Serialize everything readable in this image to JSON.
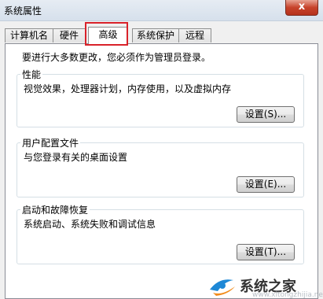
{
  "window": {
    "title": "系统属性",
    "close_glyph": "x"
  },
  "tabs": [
    {
      "label": "计算机名"
    },
    {
      "label": "硬件"
    },
    {
      "label": "高级"
    },
    {
      "label": "系统保护"
    },
    {
      "label": "远程"
    }
  ],
  "active_tab": "高级",
  "panel": {
    "intro": "要进行大多数更改，您必须作为管理员登录。",
    "groups": [
      {
        "title": "性能",
        "description": "视觉效果，处理器计划，内存使用，以及虚拟内存",
        "button": "设置(S)..."
      },
      {
        "title": "用户配置文件",
        "description": "与您登录有关的桌面设置",
        "button": "设置(E)..."
      },
      {
        "title": "启动和故障恢复",
        "description": "系统启动、系统失败和调试信息",
        "button": "设置(T)..."
      }
    ]
  },
  "watermark": {
    "text": "系统之家",
    "url": "www.xitongzhijia.net",
    "colors": {
      "logo_blue": "#1e88d6",
      "logo_orange": "#f28c1b"
    }
  },
  "colors": {
    "highlight_box": "#d9222a",
    "dialog_bg": "#f0f0f0",
    "panel_bg": "#ffffff"
  }
}
